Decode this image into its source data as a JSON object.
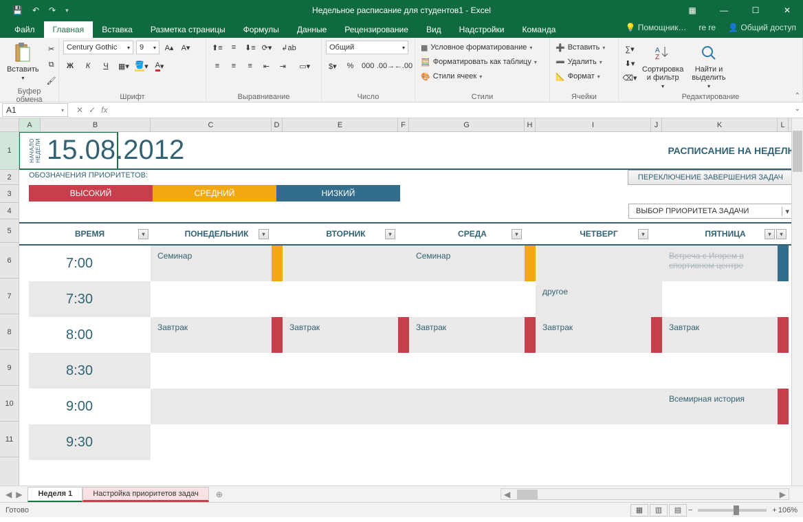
{
  "app": {
    "title": "Недельное расписание для студентов1 - Excel"
  },
  "qat": {
    "save": "💾",
    "undo": "↶",
    "redo": "↷"
  },
  "winctrl": {
    "ribbonopts": "▦",
    "min": "—",
    "max": "☐",
    "close": "✕"
  },
  "tabs": {
    "file": "Файл",
    "home": "Главная",
    "insert": "Вставка",
    "layout": "Разметка страницы",
    "formulas": "Формулы",
    "data": "Данные",
    "review": "Рецензирование",
    "view": "Вид",
    "addins": "Надстройки",
    "team": "Команда",
    "tellme": "Помощник…",
    "user": "re re",
    "share": "Общий доступ"
  },
  "ribbon": {
    "clipboard": {
      "label": "Буфер обмена",
      "paste": "Вставить"
    },
    "font": {
      "label": "Шрифт",
      "name": "Century Gothic",
      "size": "9",
      "bold": "Ж",
      "italic": "К",
      "underline": "Ч"
    },
    "align": {
      "label": "Выравнивание"
    },
    "number": {
      "label": "Число",
      "format": "Общий"
    },
    "styles": {
      "label": "Стили",
      "cond": "Условное форматирование",
      "table": "Форматировать как таблицу",
      "cell": "Стили ячеек"
    },
    "cells": {
      "label": "Ячейки",
      "insert": "Вставить",
      "delete": "Удалить",
      "format": "Формат"
    },
    "editing": {
      "label": "Редактирование",
      "sort": "Сортировка\nи фильтр",
      "find": "Найти и\nвыделить"
    }
  },
  "namebox": "A1",
  "fx": {
    "label": "fx"
  },
  "cols": {
    "A": "A",
    "B": "B",
    "C": "C",
    "D": "D",
    "E": "E",
    "F": "F",
    "G": "G",
    "H": "H",
    "I": "I",
    "J": "J",
    "K": "K",
    "L": "L"
  },
  "rows": {
    "r1": "1",
    "r2": "2",
    "r3": "3",
    "r4": "4",
    "r5": "5",
    "r6": "6",
    "r7": "7",
    "r8": "8",
    "r9": "9",
    "r10": "10",
    "r11": "11"
  },
  "content": {
    "weeklabel": "НАЧАЛО\nНЕДЕЛИ",
    "date": "15.08.2012",
    "scheduletitle": "РАСПИСАНИЕ НА НЕДЕЛЮ",
    "prioheader": "ОБОЗНАЧЕНИЯ ПРИОРИТЕТОВ:",
    "prio": {
      "high": "ВЫСОКИЙ",
      "mid": "СРЕДНИЙ",
      "low": "НИЗКИЙ"
    },
    "togglebtn": "ПЕРЕКЛЮЧЕНИЕ ЗАВЕРШЕНИЯ ЗАДАЧ",
    "prioselect": "ВЫБОР ПРИОРИТЕТА ЗАДАЧИ",
    "headers": {
      "time": "ВРЕМЯ",
      "mon": "ПОНЕДЕЛЬНИК",
      "tue": "ВТОРНИК",
      "wed": "СРЕДА",
      "thu": "ЧЕТВЕРГ",
      "fri": "ПЯТНИЦА"
    },
    "times": {
      "t1": "7:00",
      "t2": "7:30",
      "t3": "8:00",
      "t4": "8:30",
      "t5": "9:00",
      "t6": "9:30"
    },
    "data": {
      "r6": {
        "mon": "Семинар",
        "wed": "Семинар",
        "fri": "Встреча с Игорем в спортивном центре"
      },
      "r7": {
        "thu": "другое"
      },
      "r8": {
        "mon": "Завтрак",
        "tue": "Завтрак",
        "wed": "Завтрак",
        "thu": "Завтрак",
        "fri": "Завтрак"
      },
      "r10": {
        "fri": "Всемирная история"
      }
    }
  },
  "sheets": {
    "s1": "Неделя 1",
    "s2": "Настройка приоритетов задач",
    "add": "⊕"
  },
  "status": {
    "ready": "Готово",
    "zoom": "106%"
  }
}
